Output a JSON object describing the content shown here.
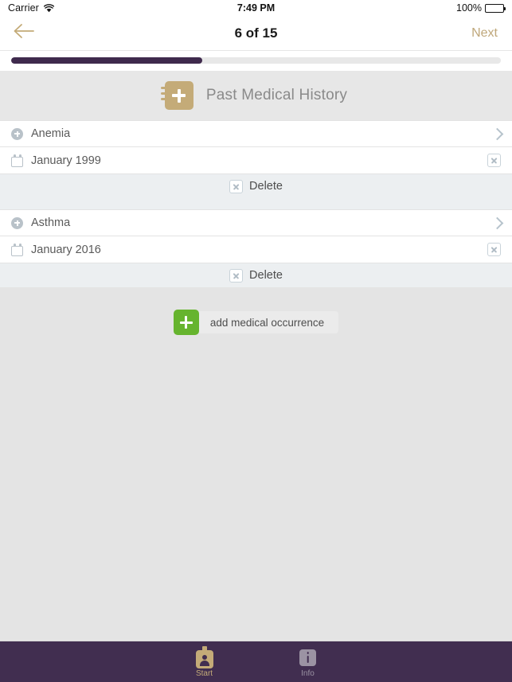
{
  "status_bar": {
    "carrier": "Carrier",
    "wifi_icon": "wifi-icon",
    "time": "7:49 PM",
    "battery_percent": "100%",
    "battery_level": 100
  },
  "nav_bar": {
    "back_icon": "arrow-left-icon",
    "title": "6 of 15",
    "next_label": "Next",
    "accent_color": "#bfa77a"
  },
  "progress": {
    "current": 6,
    "total": 15,
    "percent": 39,
    "fill_color": "#3f2a4d",
    "track_color": "#e8e8e8"
  },
  "page_header": {
    "icon": "medical-record-plus-icon",
    "icon_color": "#c4ab78",
    "title": "Past Medical History"
  },
  "groups": [
    {
      "condition": {
        "icon": "circle-plus-icon",
        "label": "Anemia",
        "chevron_icon": "chevron-right-icon"
      },
      "date": {
        "icon": "calendar-icon",
        "label": "January 1999",
        "clear_icon": "x-box-icon"
      },
      "delete": {
        "icon": "x-box-icon",
        "label": "Delete"
      }
    },
    {
      "condition": {
        "icon": "circle-plus-icon",
        "label": "Asthma",
        "chevron_icon": "chevron-right-icon"
      },
      "date": {
        "icon": "calendar-icon",
        "label": "January 2016",
        "clear_icon": "x-box-icon"
      },
      "delete": {
        "icon": "x-box-icon",
        "label": "Delete"
      }
    }
  ],
  "add_button": {
    "icon": "plus-icon",
    "icon_color": "#66b42e",
    "label": "add medical occurrence"
  },
  "tab_bar": {
    "background_color": "#412e50",
    "items": [
      {
        "icon": "id-badge-icon",
        "label": "Start",
        "active": true
      },
      {
        "icon": "info-icon",
        "label": "Info",
        "active": false
      }
    ]
  }
}
